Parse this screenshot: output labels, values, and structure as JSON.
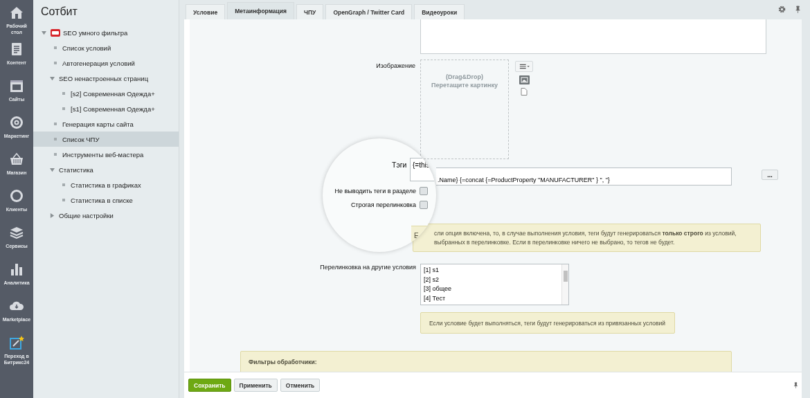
{
  "nav": [
    {
      "label": "Рабочий стол"
    },
    {
      "label": "Контент"
    },
    {
      "label": "Сайты"
    },
    {
      "label": "Маркетинг"
    },
    {
      "label": "Магазин"
    },
    {
      "label": "Клиенты"
    },
    {
      "label": "Сервисы"
    },
    {
      "label": "Аналитика"
    },
    {
      "label": "Marketplace"
    },
    {
      "label": "Переход в Битрикс24"
    }
  ],
  "menu": {
    "title": "Сотбит",
    "items": [
      {
        "label": "SEO умного фильтра",
        "kind": "branch",
        "expanded": true,
        "selected": false,
        "children": [
          {
            "label": "Список условий",
            "kind": "leaf",
            "selected": false
          },
          {
            "label": "Автогенерация условий",
            "kind": "leaf",
            "selected": false
          },
          {
            "label": "SEO ненастроенных страниц",
            "kind": "branch",
            "expanded": true,
            "selected": false,
            "children": [
              {
                "label": "[s2] Современная Одежда+",
                "kind": "leaf",
                "selected": false
              },
              {
                "label": "[s1] Современная Одежда+",
                "kind": "leaf",
                "selected": false
              }
            ]
          },
          {
            "label": "Генерация карты сайта",
            "kind": "leaf",
            "selected": false
          },
          {
            "label": "Список ЧПУ",
            "kind": "leaf",
            "selected": true
          },
          {
            "label": "Инструменты веб-мастера",
            "kind": "leaf",
            "selected": false
          },
          {
            "label": "Статистика",
            "kind": "branch",
            "expanded": true,
            "selected": false,
            "children": [
              {
                "label": "Статистика в графиках",
                "kind": "leaf",
                "selected": false
              },
              {
                "label": "Статистика в списке",
                "kind": "leaf",
                "selected": false
              }
            ]
          },
          {
            "label": "Общие настройки",
            "kind": "branch",
            "expanded": false,
            "selected": false
          }
        ]
      }
    ]
  },
  "tabs": [
    {
      "label": "Условие",
      "selected": false
    },
    {
      "label": "Метаинформация",
      "selected": true
    },
    {
      "label": "ЧПУ",
      "selected": false
    },
    {
      "label": "OpenGraph / Twitter Card",
      "selected": false
    },
    {
      "label": "Видеоуроки",
      "selected": false
    }
  ],
  "form": {
    "image": {
      "label": "Изображение",
      "drop_hint": "(Drag&Drop)",
      "drop_text": "Перетащите картинку"
    },
    "tags": {
      "label": "Тэги",
      "value_start": "{=this",
      "value_rest": ".Name} {=concat {=ProductProperty \"MANUFACTURER\" } \", \"}",
      "more_button": "..."
    },
    "checkboxes": [
      {
        "label": "Не выводить теги в разделе",
        "checked": false
      },
      {
        "label": "Строгая перелинковка",
        "checked": false
      }
    ],
    "strict_note": {
      "first_letter": "Е",
      "text": "сли опция включена, то, в случае выполнения условия, теги будут генерироваться **только строго** из условий, выбранных в перелинковке. Если в перелинковке ничего не выбрано, то тегов не будет."
    },
    "linking": {
      "label": "Перелинковка на другие условия",
      "options": [
        {
          "label": "[1] s1",
          "selected": false
        },
        {
          "label": "[2] s2",
          "selected": false
        },
        {
          "label": "[3] общее",
          "selected": false
        },
        {
          "label": "[4] Тест",
          "selected": false
        }
      ]
    },
    "linking_note": "Если условие будет выполняться, теги будут генерироваться из привязанных условий",
    "filters_title": "Фильтры обработчики:"
  },
  "buttons": [
    {
      "label": "Сохранить",
      "kind": "primary"
    },
    {
      "label": "Применить",
      "kind": "normal"
    },
    {
      "label": "Отменить",
      "kind": "normal"
    }
  ]
}
